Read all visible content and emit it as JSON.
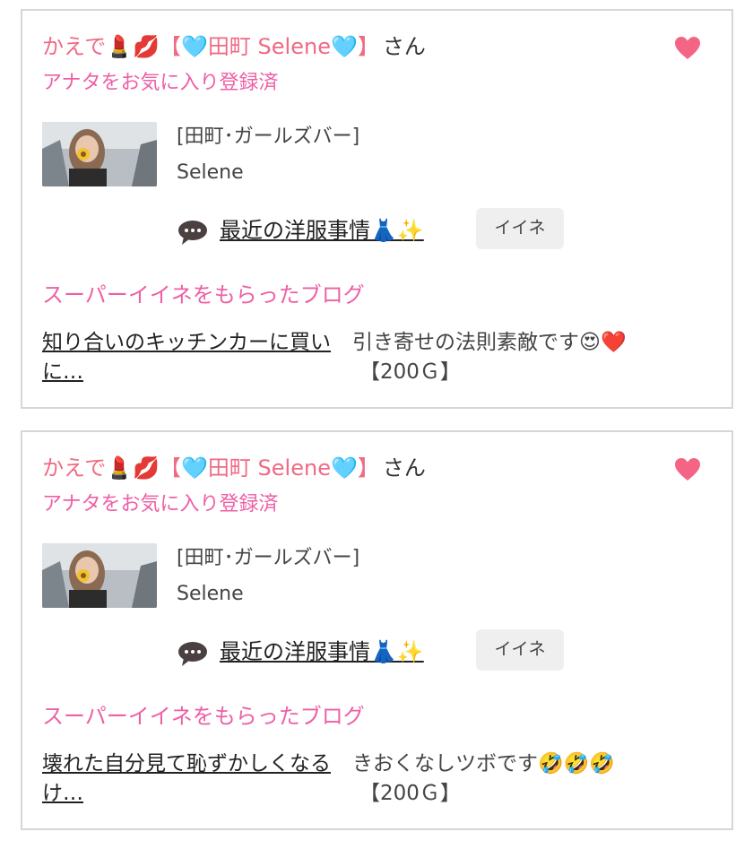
{
  "cards": [
    {
      "user_name": "かえで💄💋【🩵田町 Selene🩵】",
      "san": "さん",
      "favorite_status": "アナタをお気に入り登録済",
      "shop": "[田町･ガールズバー]",
      "girl_name": "Selene",
      "blog_title": "最近の洋服事情👗✨",
      "like_label": "イイネ",
      "super_heading": "スーパーイイネをもらったブログ",
      "super_blog_title": "知り合いのキッチンカーに買いに…",
      "comment": "引き寄せの法則素敵です😍❤️",
      "gold": "【200Ｇ】"
    },
    {
      "user_name": "かえで💄💋【🩵田町 Selene🩵】",
      "san": "さん",
      "favorite_status": "アナタをお気に入り登録済",
      "shop": "[田町･ガールズバー]",
      "girl_name": "Selene",
      "blog_title": "最近の洋服事情👗✨",
      "like_label": "イイネ",
      "super_heading": "スーパーイイネをもらったブログ",
      "super_blog_title": "壊れた自分見て恥ずかしくなるけ…",
      "comment": "きおくなしツボです🤣🤣🤣",
      "gold": "【200Ｇ】"
    }
  ],
  "colors": {
    "name": "#f06a84",
    "pink": "#ee5fa6",
    "heart": "#f46585",
    "like_bg": "#efefef",
    "border": "#d6d6d6"
  },
  "icons": {
    "heart": "heart-icon",
    "bubble": "speech-bubble-icon"
  }
}
